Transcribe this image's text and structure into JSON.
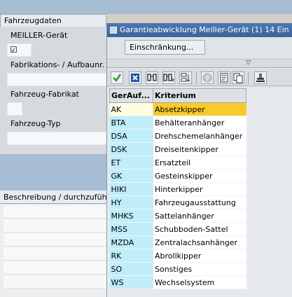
{
  "background": {
    "section_title": "Fahrzeugdaten",
    "meiller_label": "MEILLER-Gerät",
    "meiller_checked_mark": "☑",
    "fabrikation_label": "Fabrikations- / Aufbaunr.",
    "fahrzeug_fabrikat_label": "Fahrzeug-Fabrikat",
    "fahrzeug_typ_label": "Fahrzeug-Typ",
    "beschreibung_label": "Beschreibung / durchzuführ"
  },
  "dialog": {
    "title": "Garantieabwicklung Meiller-Gerät (1)   14 Ein",
    "restrict_button": "Einschränkung...",
    "expander_arrow": "▽",
    "toolbar": [
      {
        "name": "continue-icon",
        "color": "#2a9a2a"
      },
      {
        "name": "cancel-icon",
        "color": "#2550a8"
      },
      {
        "name": "find-icon",
        "color": "#333333"
      },
      {
        "name": "find-next-icon",
        "color": "#333333"
      },
      {
        "name": "sort-icon",
        "color": "#333333"
      },
      {
        "name": "help-icon",
        "color": "#a0a0a0"
      },
      {
        "name": "document-icon",
        "color": "#333333"
      },
      {
        "name": "copy-icon",
        "color": "#333333"
      },
      {
        "name": "stamp-icon",
        "color": "#333333"
      }
    ],
    "columns": {
      "code": "GerAuf...",
      "criterion": "Kriterium"
    },
    "rows": [
      {
        "code": "AK",
        "criterion": "Absetzkipper",
        "selected": true
      },
      {
        "code": "BTA",
        "criterion": "Behälteranhänger"
      },
      {
        "code": "DSA",
        "criterion": "Drehschemelanhänger"
      },
      {
        "code": "DSK",
        "criterion": "Dreiseitenkipper"
      },
      {
        "code": "ET",
        "criterion": "Ersatzteil"
      },
      {
        "code": "GK",
        "criterion": "Gesteinskipper"
      },
      {
        "code": "HIKI",
        "criterion": "Hinterkipper"
      },
      {
        "code": "HY",
        "criterion": "Fahrzeugausstattung"
      },
      {
        "code": "MHKS",
        "criterion": "Sattelanhänger"
      },
      {
        "code": "MSS",
        "criterion": "Schubboden-Sattel"
      },
      {
        "code": "MZDA",
        "criterion": "Zentralachsanhänger"
      },
      {
        "code": "RK",
        "criterion": "Abrollkipper"
      },
      {
        "code": "SO",
        "criterion": "Sonstiges"
      },
      {
        "code": "WS",
        "criterion": "Wechselsystem"
      }
    ]
  }
}
